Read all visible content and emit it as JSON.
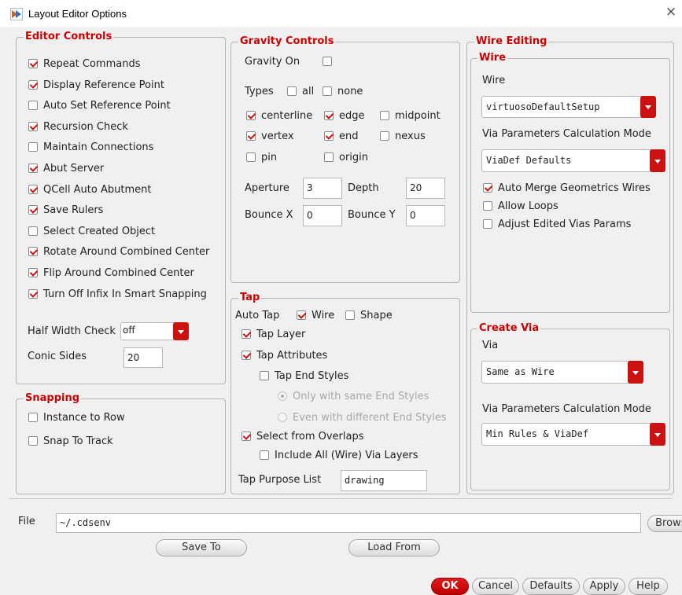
{
  "window": {
    "title": "Layout Editor Options",
    "close_glyph": "×",
    "icon": "cadence-app-icon"
  },
  "editor_controls": {
    "legend": "Editor Controls",
    "checkboxes": [
      {
        "label": "Repeat Commands",
        "checked": true
      },
      {
        "label": "Display Reference Point",
        "checked": true
      },
      {
        "label": "Auto Set Reference Point",
        "checked": false
      },
      {
        "label": "Recursion Check",
        "checked": true
      },
      {
        "label": "Maintain Connections",
        "checked": false
      },
      {
        "label": "Abut Server",
        "checked": true
      },
      {
        "label": "QCell Auto Abutment",
        "checked": true
      },
      {
        "label": "Save Rulers",
        "checked": true
      },
      {
        "label": "Select Created Object",
        "checked": false
      },
      {
        "label": "Rotate Around Combined Center",
        "checked": true
      },
      {
        "label": "Flip Around Combined Center",
        "checked": true
      },
      {
        "label": "Turn Off Infix In Smart Snapping",
        "checked": true
      }
    ],
    "half_width_check": {
      "label": "Half Width Check",
      "value": "off"
    },
    "conic_sides": {
      "label": "Conic Sides",
      "value": "20"
    }
  },
  "snapping": {
    "legend": "Snapping",
    "checkboxes": [
      {
        "label": "Instance to Row",
        "checked": false
      },
      {
        "label": "Snap To Track",
        "checked": false
      }
    ]
  },
  "gravity_controls": {
    "legend": "Gravity Controls",
    "gravity_on": {
      "label": "Gravity On",
      "checked": false
    },
    "types_label": "Types",
    "all": {
      "label": "all",
      "checked": false
    },
    "none": {
      "label": "none",
      "checked": false
    },
    "centerline": {
      "label": "centerline",
      "checked": true
    },
    "edge": {
      "label": "edge",
      "checked": true
    },
    "midpoint": {
      "label": "midpoint",
      "checked": false
    },
    "vertex": {
      "label": "vertex",
      "checked": true
    },
    "end": {
      "label": "end",
      "checked": true
    },
    "nexus": {
      "label": "nexus",
      "checked": false
    },
    "pin": {
      "label": "pin",
      "checked": false
    },
    "origin": {
      "label": "origin",
      "checked": false
    },
    "aperture": {
      "label": "Aperture",
      "value": "3"
    },
    "depth": {
      "label": "Depth",
      "value": "20"
    },
    "bounce_x": {
      "label": "Bounce X",
      "value": "0"
    },
    "bounce_y": {
      "label": "Bounce Y",
      "value": "0"
    }
  },
  "tap": {
    "legend": "Tap",
    "auto_tap_label": "Auto Tap",
    "wire": {
      "label": "Wire",
      "checked": true
    },
    "shape": {
      "label": "Shape",
      "checked": false
    },
    "tap_layer": {
      "label": "Tap Layer",
      "checked": true
    },
    "tap_attributes": {
      "label": "Tap Attributes",
      "checked": true
    },
    "tap_end_styles": {
      "label": "Tap End Styles",
      "checked": false
    },
    "only_same": {
      "label": "Only with same End Styles",
      "selected": true
    },
    "even_different": {
      "label": "Even with different End Styles",
      "selected": false
    },
    "select_from_overlaps": {
      "label": "Select from Overlaps",
      "checked": true
    },
    "include_all_via": {
      "label": "Include All (Wire) Via Layers",
      "checked": false
    },
    "purpose_list": {
      "label": "Tap Purpose List",
      "value": "drawing"
    }
  },
  "wire_editing": {
    "legend": "Wire Editing",
    "wire_group": {
      "legend": "Wire",
      "wire_label": "Wire",
      "wire_value": "virtuosoDefaultSetup",
      "via_calc_label": "Via Parameters Calculation Mode",
      "via_calc_value": "ViaDef Defaults",
      "auto_merge": {
        "label": "Auto Merge Geometrics Wires",
        "checked": true
      },
      "allow_loops": {
        "label": "Allow Loops",
        "checked": false
      },
      "adjust_vias": {
        "label": "Adjust Edited Vias Params",
        "checked": false
      }
    },
    "create_via": {
      "legend": "Create Via",
      "via_label": "Via",
      "via_value": "Same as Wire",
      "via_calc_label": "Via Parameters Calculation Mode",
      "via_calc_value": "Min Rules & ViaDef"
    }
  },
  "file": {
    "label": "File",
    "value": "~/.cdsenv",
    "browse": "Browse...",
    "save_to": "Save To",
    "load_from": "Load From"
  },
  "buttons": {
    "ok": "OK",
    "cancel": "Cancel",
    "defaults": "Defaults",
    "apply": "Apply",
    "help": "Help"
  },
  "colors": {
    "accent": "#cc1111",
    "legend": "#cc0000",
    "background": "#f0f0f0"
  }
}
